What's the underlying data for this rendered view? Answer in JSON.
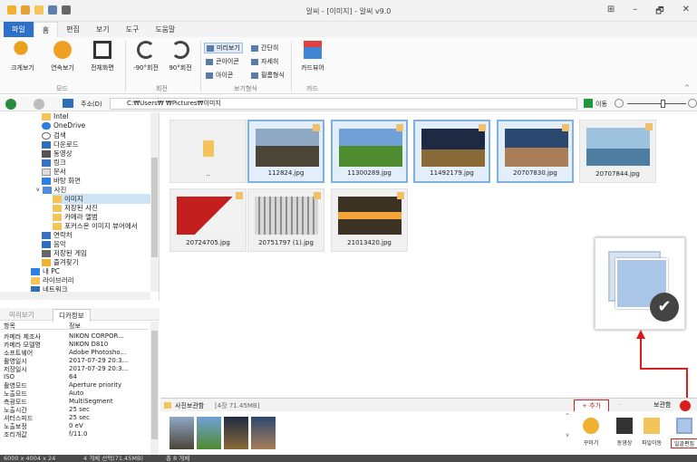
{
  "window": {
    "title": "알씨 - [이미지] - 알씨 v9.0",
    "controls": [
      "⊞",
      "–",
      "🗗",
      "✕"
    ]
  },
  "tabs": [
    "파일",
    "홈",
    "편집",
    "보기",
    "도구",
    "도움말"
  ],
  "ribbon": {
    "mode": {
      "label": "모드",
      "buttons": [
        "크게보기",
        "연속보기",
        "전체화면"
      ]
    },
    "rotate": {
      "label": "회전",
      "buttons": [
        "-90°회전",
        "90°회전"
      ]
    },
    "view": {
      "label": "보기형식",
      "items": [
        "미리보기",
        "간단히",
        "큰아이콘",
        "자세히",
        "아이콘",
        "필름형식"
      ]
    },
    "card": {
      "label": "카드",
      "buttons": [
        "카드뷰어"
      ]
    }
  },
  "address": {
    "label": "주소(D)",
    "path": "C:₩Users₩                 ₩Pictures₩이미지",
    "go": "이동"
  },
  "tree": [
    {
      "label": "Intel",
      "sel": false
    },
    {
      "label": "OneDrive",
      "sel": false
    },
    {
      "label": "검색",
      "sel": false
    },
    {
      "label": "다운로드",
      "sel": false
    },
    {
      "label": "동영상",
      "sel": false
    },
    {
      "label": "링크",
      "sel": false
    },
    {
      "label": "문서",
      "sel": false
    },
    {
      "label": "바탕 화면",
      "sel": false
    },
    {
      "label": "사진",
      "sel": false
    },
    {
      "label": "이미지",
      "sel": true
    },
    {
      "label": "저장된 사진",
      "sel": false
    },
    {
      "label": "카메라 앨범",
      "sel": false
    },
    {
      "label": "포커스온 이미지 뷰어에서",
      "sel": false
    },
    {
      "label": "연락처",
      "sel": false
    },
    {
      "label": "음악",
      "sel": false
    },
    {
      "label": "저장된 게임",
      "sel": false
    },
    {
      "label": "즐겨찾기",
      "sel": false
    },
    {
      "label": "내 PC",
      "sel": false
    },
    {
      "label": "라이브러리",
      "sel": false
    },
    {
      "label": "네트워크",
      "sel": false
    }
  ],
  "props_tabs": [
    "미리보기",
    "디카정보"
  ],
  "props_header": {
    "k": "항목",
    "v": "정보"
  },
  "props": [
    {
      "k": "카메라 제조사",
      "v": "NIKON CORPOR..."
    },
    {
      "k": "카메라 모델명",
      "v": "NIKON D810"
    },
    {
      "k": "소프트웨어",
      "v": "Adobe Photosho..."
    },
    {
      "k": "촬영일시",
      "v": "2017-07-29  20:3..."
    },
    {
      "k": "저장일시",
      "v": "2017-07-29  20:3..."
    },
    {
      "k": "ISO",
      "v": "64"
    },
    {
      "k": "촬영모드",
      "v": "Aperture priority"
    },
    {
      "k": "노출모드",
      "v": "Auto"
    },
    {
      "k": "측광모드",
      "v": "MultiSegment"
    },
    {
      "k": "노출시간",
      "v": "25 sec"
    },
    {
      "k": "셔터스피드",
      "v": "25 sec"
    },
    {
      "k": "노출보정",
      "v": "0 eV"
    },
    {
      "k": "조리개값",
      "v": "f/11.0"
    }
  ],
  "thumbs": [
    {
      "name": "..",
      "sel": false,
      "c1": "#ffffff",
      "c2": "#ffffff"
    },
    {
      "name": "112824.jpg",
      "sel": true,
      "c1": "#8fa8c4",
      "c2": "#4b4538"
    },
    {
      "name": "11300289.jpg",
      "sel": true,
      "c1": "#6fa0d8",
      "c2": "#4f8b2f"
    },
    {
      "name": "11492179.jpg",
      "sel": true,
      "c1": "#1e2a44",
      "c2": "#8a6a36"
    },
    {
      "name": "20707830.jpg",
      "sel": true,
      "c1": "#2c4870",
      "c2": "#a87d58"
    },
    {
      "name": "20707844.jpg",
      "sel": false,
      "c1": "#9dc2de",
      "c2": "#4d7ea1"
    },
    {
      "name": "20724705.jpg",
      "sel": false,
      "c1": "#c41f1f",
      "c2": "#f2f2f2"
    },
    {
      "name": "20751797 (1).jpg",
      "sel": false,
      "c1": "#d7d7d7",
      "c2": "#8e8e8e"
    },
    {
      "name": "21013420.jpg",
      "sel": false,
      "c1": "#3d3325",
      "c2": "#f3a43a"
    }
  ],
  "tray": {
    "title": "사진보관함",
    "info": "[4장 71.45MB]",
    "add": "+ 추가",
    "minus": "–",
    "save": "보관함"
  },
  "tools": [
    "꾸미기",
    "동영상",
    "파일이동",
    "일괄편집"
  ],
  "status": {
    "dims": "6000 x 4004 x 24",
    "selection": "4 개체 선택(71.45MB)",
    "total": "총 8 개체"
  },
  "colors": {
    "accent": "#2d6fc9",
    "callout": "#d91c1c"
  }
}
